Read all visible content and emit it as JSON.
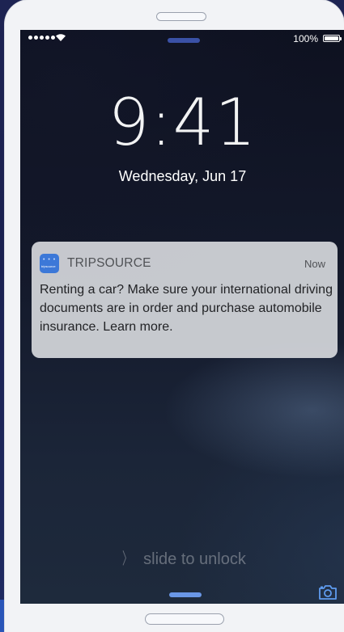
{
  "status_bar": {
    "battery_percent": "100%"
  },
  "lock_screen": {
    "time": "9:41",
    "date": "Wednesday, Jun 17",
    "slide_text": "slide to unlock"
  },
  "notification": {
    "app_name": "TRIPSOURCE",
    "time": "Now",
    "body": "Renting a car? Make sure your international driving documents are in order and purchase automobile insurance. Learn more.",
    "app_icon_text": "tripsource"
  },
  "icons": {
    "signal": "signal-dots-icon",
    "wifi": "wifi-icon",
    "battery": "battery-icon",
    "camera": "camera-icon",
    "chevron": "chevron-right-icon",
    "app": "tripsource-app-icon"
  },
  "colors": {
    "background": "#1d2352",
    "accent_blue": "#3c78d8",
    "grabber_top": "#3a51a6",
    "grabber_bottom": "#6a97e6",
    "notification_bg": "#d6d8dc"
  }
}
